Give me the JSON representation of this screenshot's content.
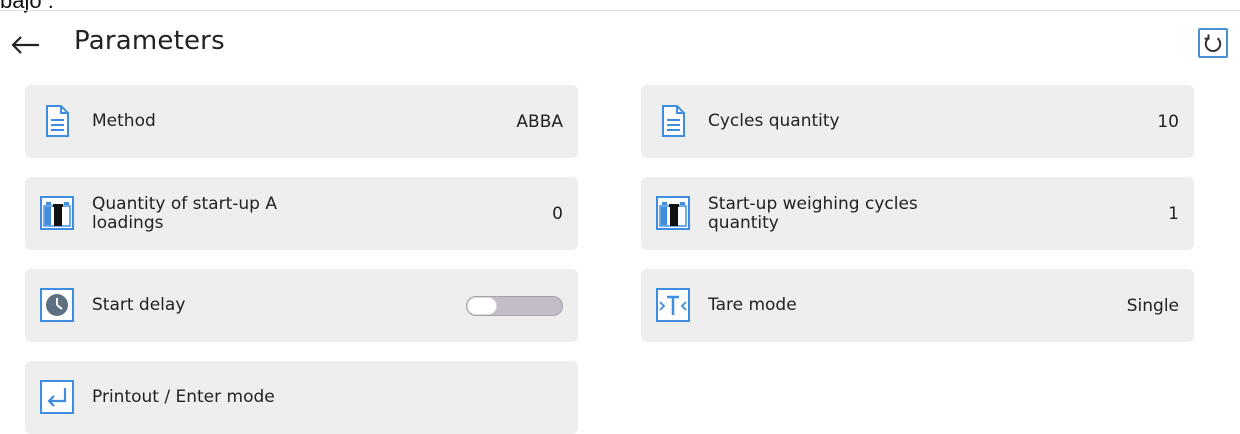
{
  "top_fragment": "bajo :",
  "header": {
    "title": "Parameters"
  },
  "tiles": [
    {
      "label": "Method",
      "value": "ABBA",
      "icon": "document-icon"
    },
    {
      "label": "Cycles quantity",
      "value": "10",
      "icon": "document-icon"
    },
    {
      "label": "Quantity of start-up A loadings",
      "value": "0",
      "icon": "weight-icon"
    },
    {
      "label": "Start-up weighing cycles quantity",
      "value": "1",
      "icon": "weight-icon"
    },
    {
      "label": "Start delay",
      "toggle_on": false,
      "icon": "clock-icon"
    },
    {
      "label": "Tare mode",
      "value": "Single",
      "icon": "tare-icon"
    },
    {
      "label": "Printout / Enter mode",
      "icon": "enter-icon"
    }
  ],
  "colors": {
    "accent": "#4a90d9",
    "tile_bg": "#eeeeee",
    "toggle_track": "#c4bcc8"
  }
}
